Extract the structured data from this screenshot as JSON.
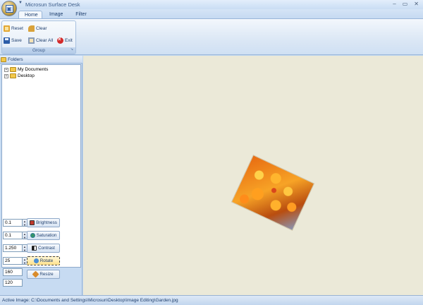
{
  "window": {
    "title": "Microsun Surface Desk",
    "controls": {
      "minimize": "–",
      "maximize": "▭",
      "close": "✕"
    }
  },
  "tabs": [
    {
      "label": "Home",
      "active": true
    },
    {
      "label": "Image",
      "active": false
    },
    {
      "label": "Filter",
      "active": false
    }
  ],
  "ribbon": {
    "group_label": "Group",
    "buttons": {
      "reset": "Reset",
      "clear": "Clear",
      "save": "Save",
      "clear_all": "Clear All",
      "exit": "Exit"
    }
  },
  "folders": {
    "header": "Folders",
    "items": [
      {
        "label": "My Documents"
      },
      {
        "label": "Desktop"
      }
    ]
  },
  "controls": {
    "brightness_value": "0.1",
    "brightness_label": "Brightness",
    "saturation_value": "0.1",
    "saturation_label": "Saturation",
    "contrast_value": "1.250",
    "contrast_label": "Contrast",
    "rotate_value": "25",
    "rotate_label": "Rotate",
    "resize_width": "160",
    "resize_height": "120",
    "resize_label": "Resize"
  },
  "canvas": {
    "image_rotation_degrees": 25
  },
  "status": {
    "text": "Active Image: C:\\Documents and Settings\\Microsun\\Desktop\\Image Editing\\Garden.jpg"
  },
  "colors": {
    "ribbon_accent": "#c4d9f1",
    "canvas_bg": "#ebe9d8",
    "panel_bg": "#c7dbf2"
  }
}
